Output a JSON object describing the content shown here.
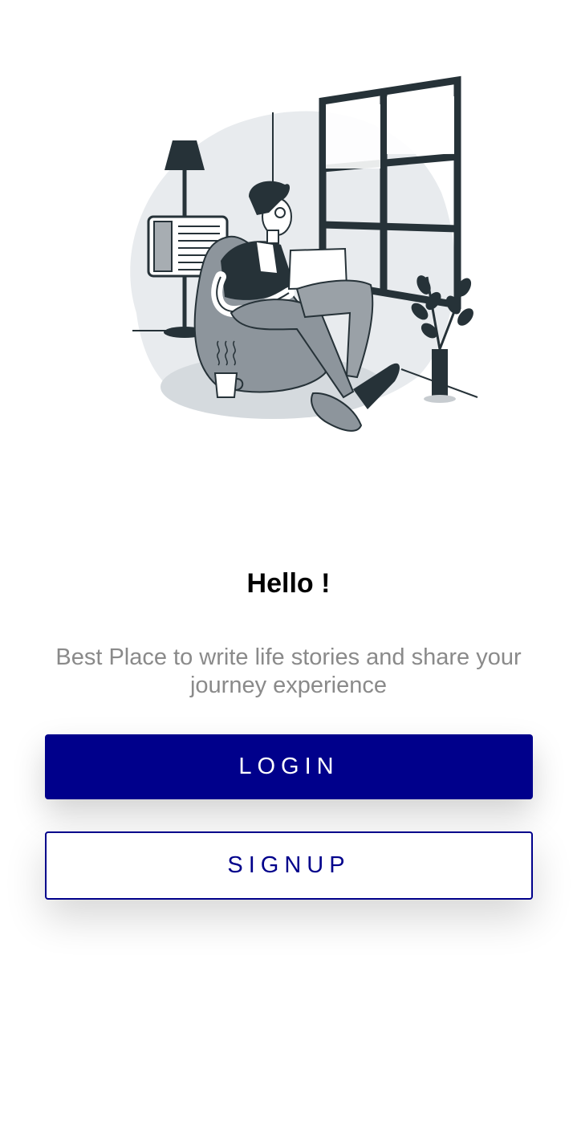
{
  "welcome": {
    "title": "Hello !",
    "subtitle": "Best Place to write life stories and share your journey experience"
  },
  "actions": {
    "login_label": "LOGIN",
    "signup_label": "SIGNUP"
  },
  "illustration": {
    "icon": "person-reading-illustration"
  },
  "colors": {
    "primary": "#00008b",
    "subtitle_text": "#8a8a8a",
    "illustration_dark": "#263238",
    "illustration_light": "#e6e9ec"
  }
}
